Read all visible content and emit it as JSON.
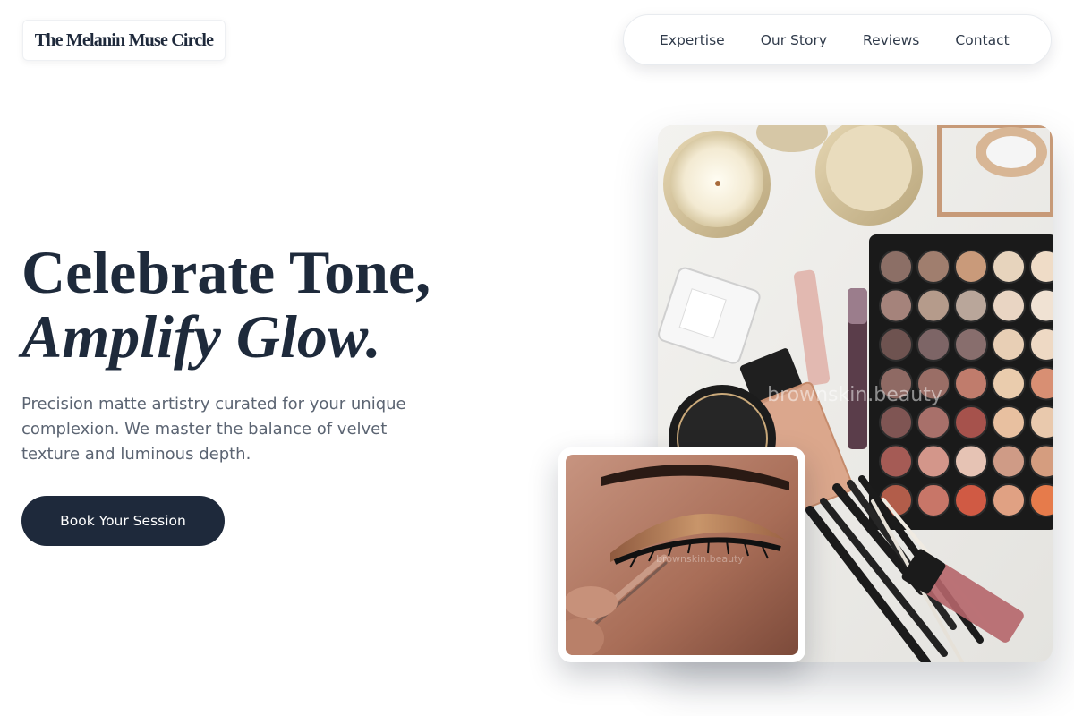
{
  "brand": {
    "name": "The Melanin Muse Circle"
  },
  "nav": {
    "items": [
      {
        "label": "Expertise"
      },
      {
        "label": "Our Story"
      },
      {
        "label": "Reviews"
      },
      {
        "label": "Contact"
      }
    ]
  },
  "hero": {
    "headline_line1": "Celebrate Tone,",
    "headline_line2": "Amplify Glow.",
    "subtext": "Precision matte artistry curated for your unique complexion. We master the balance of velvet texture and luminous depth.",
    "cta_label": "Book Your Session"
  },
  "images": {
    "main_alt": "Flat lay of makeup products with eyeshadow palette, foundation, lipsticks, brushes and candles",
    "main_watermark": "brownskin.beauty",
    "inset_alt": "Close-up of eyelash application on a bronze eyeshadow look",
    "inset_watermark": "brownskin.beauty"
  },
  "colors": {
    "primary": "#1e293b",
    "text_muted": "#5b6472",
    "background": "#ffffff"
  }
}
